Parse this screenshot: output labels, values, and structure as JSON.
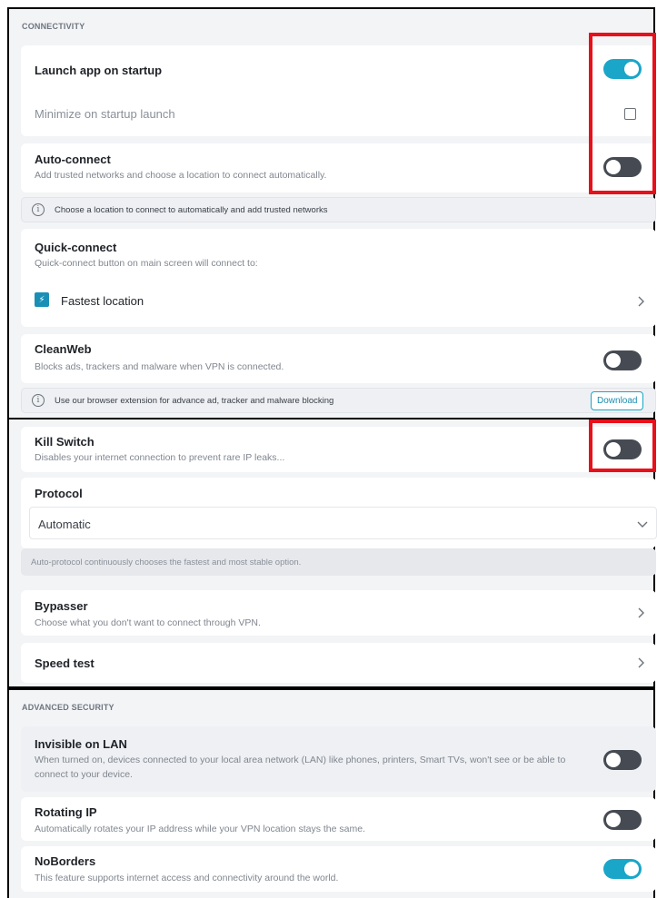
{
  "connectivity": {
    "section_title": "CONNECTIVITY",
    "launch_on_startup": {
      "label": "Launch app on startup",
      "enabled": true
    },
    "minimize_on_startup": {
      "label": "Minimize on startup launch",
      "checked": false
    },
    "auto_connect": {
      "label": "Auto-connect",
      "description": "Add trusted networks and choose a location to connect automatically.",
      "enabled": false,
      "info": "Choose a location to connect to automatically and add trusted networks"
    },
    "quick_connect": {
      "label": "Quick-connect",
      "description": "Quick-connect button on main screen will connect to:",
      "location": "Fastest location"
    },
    "cleanweb": {
      "label": "CleanWeb",
      "description": "Blocks ads, trackers and malware when VPN is connected.",
      "enabled": false,
      "info": "Use our browser extension for advance ad, tracker and malware blocking",
      "download_label": "Download"
    },
    "kill_switch": {
      "label": "Kill Switch",
      "description": "Disables your internet connection to prevent rare IP leaks...",
      "enabled": false
    },
    "protocol": {
      "label": "Protocol",
      "selected": "Automatic",
      "note": "Auto-protocol continuously chooses the fastest and most stable option."
    },
    "bypasser": {
      "label": "Bypasser",
      "description": "Choose what you don't want to connect through VPN."
    },
    "speed_test": {
      "label": "Speed test"
    }
  },
  "advanced_security": {
    "section_title": "ADVANCED SECURITY",
    "invisible_on_lan": {
      "label": "Invisible on LAN",
      "description": "When turned on, devices connected to your local area network (LAN) like phones, printers, Smart TVs, won't see or be able to connect to your device.",
      "enabled": false
    },
    "rotating_ip": {
      "label": "Rotating IP",
      "description": "Automatically rotates your IP address while your VPN location stays the same.",
      "enabled": false
    },
    "noborders": {
      "label": "NoBorders",
      "description": "This feature supports internet access and connectivity around the world.",
      "enabled": true
    }
  },
  "colors": {
    "accent": "#1aa6c8",
    "toggle_off": "#464b53",
    "highlight": "#e8101b"
  },
  "icons": {
    "info": "info-icon",
    "chevron_right": "chevron-right-icon",
    "chevron_down": "chevron-down-icon",
    "bolt": "lightning-bolt-icon"
  }
}
